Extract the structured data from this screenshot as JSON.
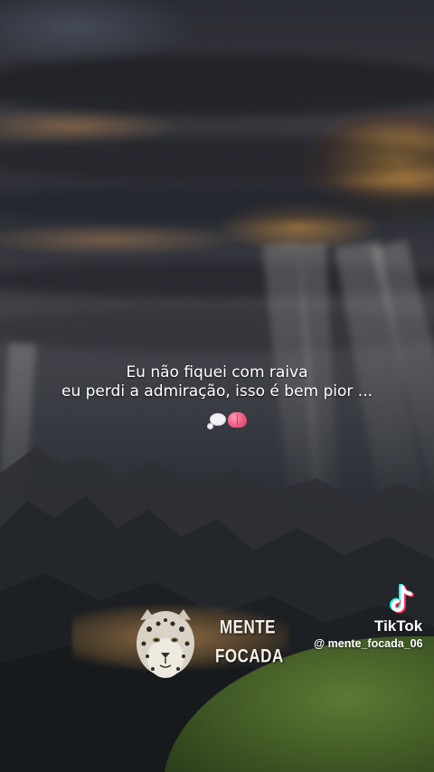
{
  "video": {
    "caption_lines": [
      "Eu não fiquei com raiva",
      "eu perdi a admiração, isso é bem pior ..."
    ],
    "emojis": [
      "thought-balloon-icon",
      "brain-icon"
    ]
  },
  "branding": {
    "mascot": "leopard-icon",
    "name_lines": [
      "MENTE",
      "FOCADA"
    ]
  },
  "watermark": {
    "logo": "tiktok-icon",
    "label": "TikTok",
    "handle": "@ mente_focada_06"
  },
  "colors": {
    "caption_text": "#ffffff",
    "brain_emoji": "#ef5b82",
    "tiktok_cyan": "#25f4ee",
    "tiktok_red": "#fe2c55"
  }
}
